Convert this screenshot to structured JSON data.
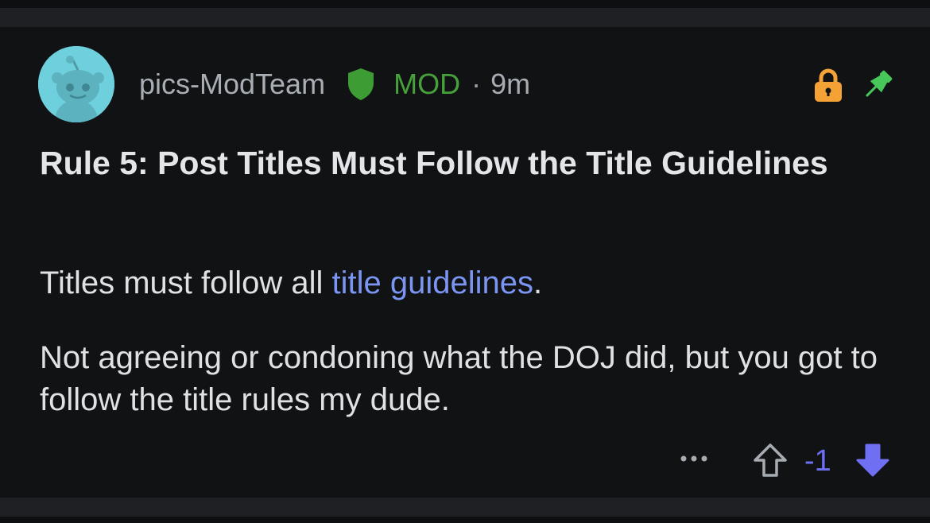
{
  "post": {
    "username": "pics-ModTeam",
    "mod_label": "MOD",
    "separator": "·",
    "time": "9m",
    "title": "Rule 5: Post Titles Must Follow the Title Guidelines",
    "body": {
      "para1_prefix": "Titles must follow all ",
      "para1_link": "title guidelines",
      "para1_suffix": ".",
      "para2": "Not agreeing or condoning what the DOJ did, but you got to follow the title rules my dude."
    }
  },
  "actions": {
    "score": "-1"
  },
  "icons": {
    "avatar": "reddit-snoo-avatar",
    "mod_badge": "shield-icon",
    "locked": "lock-icon",
    "pinned": "pin-icon",
    "more": "more-options-icon",
    "upvote": "upvote-arrow-icon",
    "downvote": "downvote-arrow-icon"
  },
  "colors": {
    "background": "#111214",
    "divider": "#1f2023",
    "mod_green": "#46a13b",
    "lock_orange": "#f4a236",
    "pin_green": "#47c65a",
    "link_blue": "#7b95f2",
    "vote_purple": "#6f6ff4",
    "avatar_bg": "#6fd0dd"
  }
}
